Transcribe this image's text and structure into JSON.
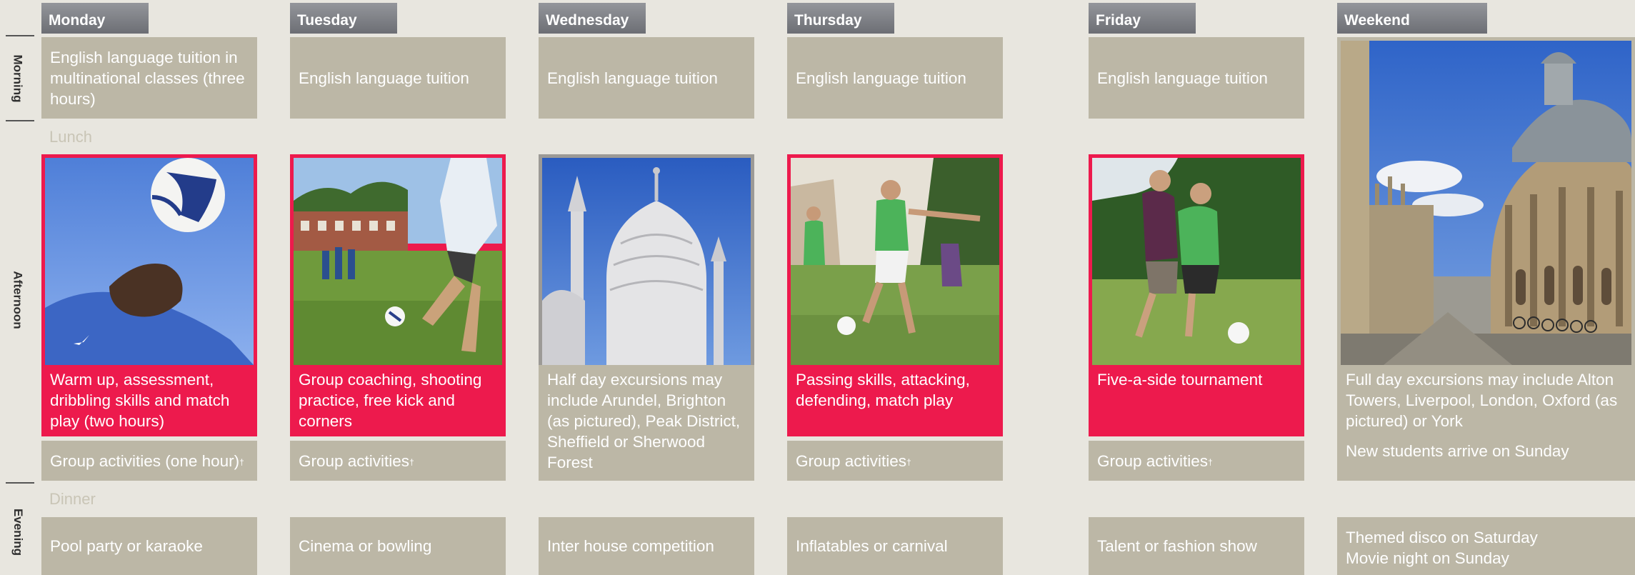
{
  "side_labels": {
    "morning": "Morning",
    "afternoon": "Afternoon",
    "evening": "Evening"
  },
  "meals": {
    "lunch": "Lunch",
    "dinner": "Dinner"
  },
  "days": [
    {
      "name": "Monday",
      "morning": "English language tuition in multinational classes (three hours)",
      "photo_icon": "header-football-photo",
      "activity": "Warm up, assessment, dribbling skills and match play (two hours)",
      "group": "Group activities (one hour)",
      "group_mark": "†",
      "evening": "Pool party or karaoke"
    },
    {
      "name": "Tuesday",
      "morning": "English language tuition",
      "photo_icon": "kick-practice-photo",
      "activity": "Group coaching, shooting practice, free kick and corners",
      "group": "Group activities",
      "group_mark": "†",
      "evening": "Cinema or bowling"
    },
    {
      "name": "Wednesday",
      "morning": "English language tuition",
      "photo_icon": "brighton-pavilion-photo",
      "activity": "Half day excursions may include Arundel, Brighton (as pictured), Peak District, Sheffield or Sherwood Forest",
      "evening": "Inter house competition"
    },
    {
      "name": "Thursday",
      "morning": "English language tuition",
      "photo_icon": "match-play-photo",
      "activity": "Passing skills, attacking, defending, match play",
      "group": "Group activities",
      "group_mark": "†",
      "evening": "Inflatables or carnival"
    },
    {
      "name": "Friday",
      "morning": "English language tuition",
      "photo_icon": "tournament-photo",
      "activity": "Five-a-side tournament",
      "group": "Group activities",
      "group_mark": "†",
      "evening": "Talent or fashion show"
    },
    {
      "name": "Weekend",
      "photo_icon": "oxford-radcliffe-camera-photo",
      "activity": "Full day excursions may include Alton Towers, Liverpool, London, Oxford (as pictured) or York",
      "arrival": "New students arrive on Sunday",
      "evening_line1": "Themed disco on Saturday",
      "evening_line2": "Movie night on Sunday"
    }
  ],
  "colors": {
    "background": "#e8e6df",
    "box_grey": "#bcb7a6",
    "accent_red": "#ed1a4d",
    "tab_grey": "#7d7f84"
  }
}
